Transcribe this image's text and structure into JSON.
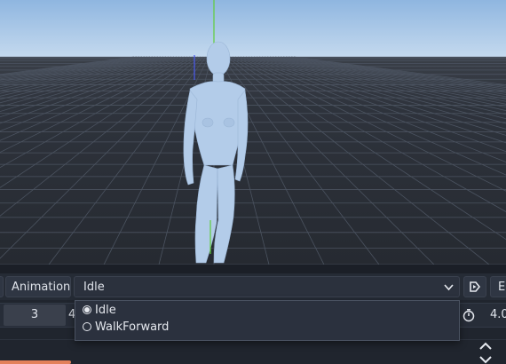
{
  "toolbar": {
    "animation_label": "Animation",
    "selected_animation": "Idle",
    "edit_label": "E"
  },
  "timeline": {
    "current_frame": "3",
    "next_frame_partial": "4",
    "length_value": "4.0"
  },
  "dropdown": {
    "options": [
      {
        "label": "Idle",
        "selected": true
      },
      {
        "label": "WalkForward",
        "selected": false
      }
    ]
  },
  "colors": {
    "sky": "#a8c6e6",
    "ground": "#2c313a",
    "grid": "#4b5360",
    "model": "#b3cce9",
    "accent_marker": "#e3805a",
    "y_axis": "#5fce3a",
    "z_axis": "#4a5af0"
  },
  "icons": {
    "chevron": "chevron-down-icon",
    "autoplay": "autoplay-icon",
    "length": "clock-icon",
    "scroll_up": "chevron-up-icon",
    "scroll_down": "chevron-down-icon"
  }
}
